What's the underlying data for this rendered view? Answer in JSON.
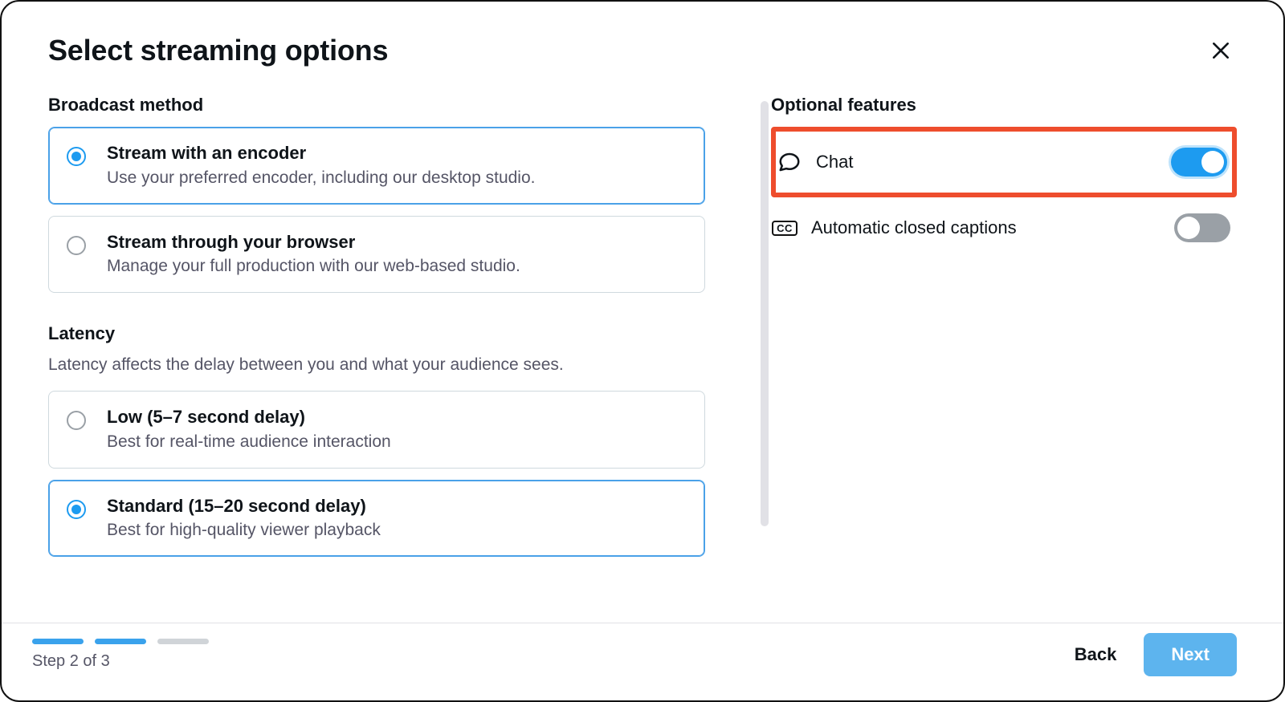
{
  "title": "Select streaming options",
  "sections": {
    "broadcast": {
      "heading": "Broadcast method",
      "options": [
        {
          "title": "Stream with an encoder",
          "desc": "Use your preferred encoder, including our desktop studio.",
          "selected": true
        },
        {
          "title": "Stream through your browser",
          "desc": "Manage your full production with our web-based studio.",
          "selected": false
        }
      ]
    },
    "latency": {
      "heading": "Latency",
      "sub": "Latency affects the delay between you and what your audience sees.",
      "options": [
        {
          "title": "Low (5–7 second delay)",
          "desc": "Best for real-time audience interaction",
          "selected": false
        },
        {
          "title": "Standard (15–20 second delay)",
          "desc": "Best for high-quality viewer playback",
          "selected": true
        }
      ]
    }
  },
  "features": {
    "heading": "Optional features",
    "items": [
      {
        "icon": "chat",
        "label": "Chat",
        "on": true,
        "highlight": true
      },
      {
        "icon": "cc",
        "label": "Automatic closed captions",
        "on": false,
        "highlight": false
      }
    ]
  },
  "footer": {
    "step_label": "Step 2 of 3",
    "progress": [
      true,
      true,
      false
    ],
    "back": "Back",
    "next": "Next"
  }
}
